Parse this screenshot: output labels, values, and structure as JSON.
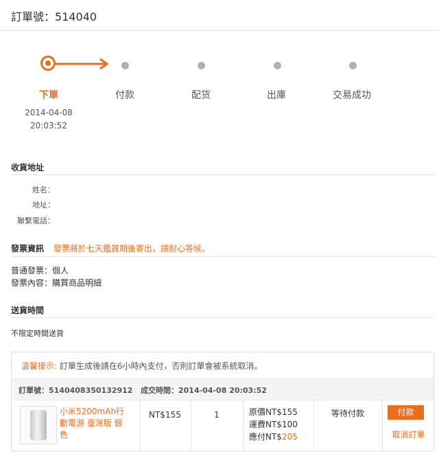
{
  "header": {
    "order_label": "訂單號：",
    "order_number": "514040"
  },
  "progress": {
    "steps": [
      {
        "label": "下單",
        "active": true,
        "date": "2014-04-08",
        "time": "20:03:52"
      },
      {
        "label": "付款"
      },
      {
        "label": "配货"
      },
      {
        "label": "出庫"
      },
      {
        "label": "交易成功"
      }
    ]
  },
  "shipping_address": {
    "title": "收貨地址",
    "name_label": "姓名：",
    "address_label": "地址：",
    "phone_label": "聯繫電話："
  },
  "invoice": {
    "title": "發票資訊",
    "notice": "發票將於七天鑑賞期後寄出，請耐心等候。",
    "type_line": "普通發票：個人",
    "content_line": "發票內容：購買商品明細"
  },
  "delivery": {
    "title": "送貨時間",
    "value": "不限定時間送貨"
  },
  "order": {
    "warning_label": "溫馨提示:",
    "warning_text": " 訂單生成後請在6小時內支付，否則訂單會被系統取消。",
    "meta_order_no": "訂單號：5140408350132912",
    "meta_deal_time": "成交時間：2014-04-08 20:03:52",
    "item": {
      "name": "小米5200mAh行動電源 臺灣版 銀色",
      "price": "NT$155",
      "quantity": "1",
      "original_price": "原價NT$155",
      "shipping_fee": "運費NT$100",
      "payable_label": "應付NT$",
      "payable_value": "205",
      "status": "等待付款",
      "pay_button": "付款",
      "cancel_link": "取消訂單"
    }
  },
  "colors": {
    "accent": "#ef6c1a",
    "inactive_dot": "#b0b0b0",
    "divider": "#e4e4e4"
  }
}
